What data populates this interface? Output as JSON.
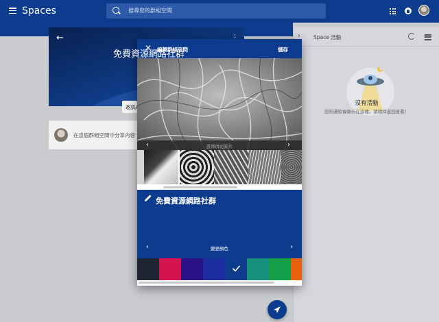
{
  "app": {
    "title": "Spaces"
  },
  "search": {
    "placeholder": "搜尋您的群組空間"
  },
  "background": {
    "space_title": "免費資源網路社群",
    "invite_label": "邀請成員",
    "share_prompt": "在這個群組空間中分享內容"
  },
  "activity_panel": {
    "title": "Space 活動",
    "empty_title": "沒有活動",
    "empty_subtitle": "您的通知會顯示在這裡。請隨時返回查看！"
  },
  "dialog": {
    "title": "編輯群組空間",
    "save_label": "儲存",
    "image_picker_label": "選擇群組圖片",
    "group_name": "免費資源網路社群",
    "color_picker_label": "變更顏色",
    "swatches": [
      "#1e2530",
      "#d6124f",
      "#2a1286",
      "#1a2d9e",
      "#0d3b8e",
      "#15907a",
      "#14a04a",
      "#e8620c"
    ],
    "selected_swatch_index": 4
  },
  "colors": {
    "brand": "#0d3b8e"
  }
}
